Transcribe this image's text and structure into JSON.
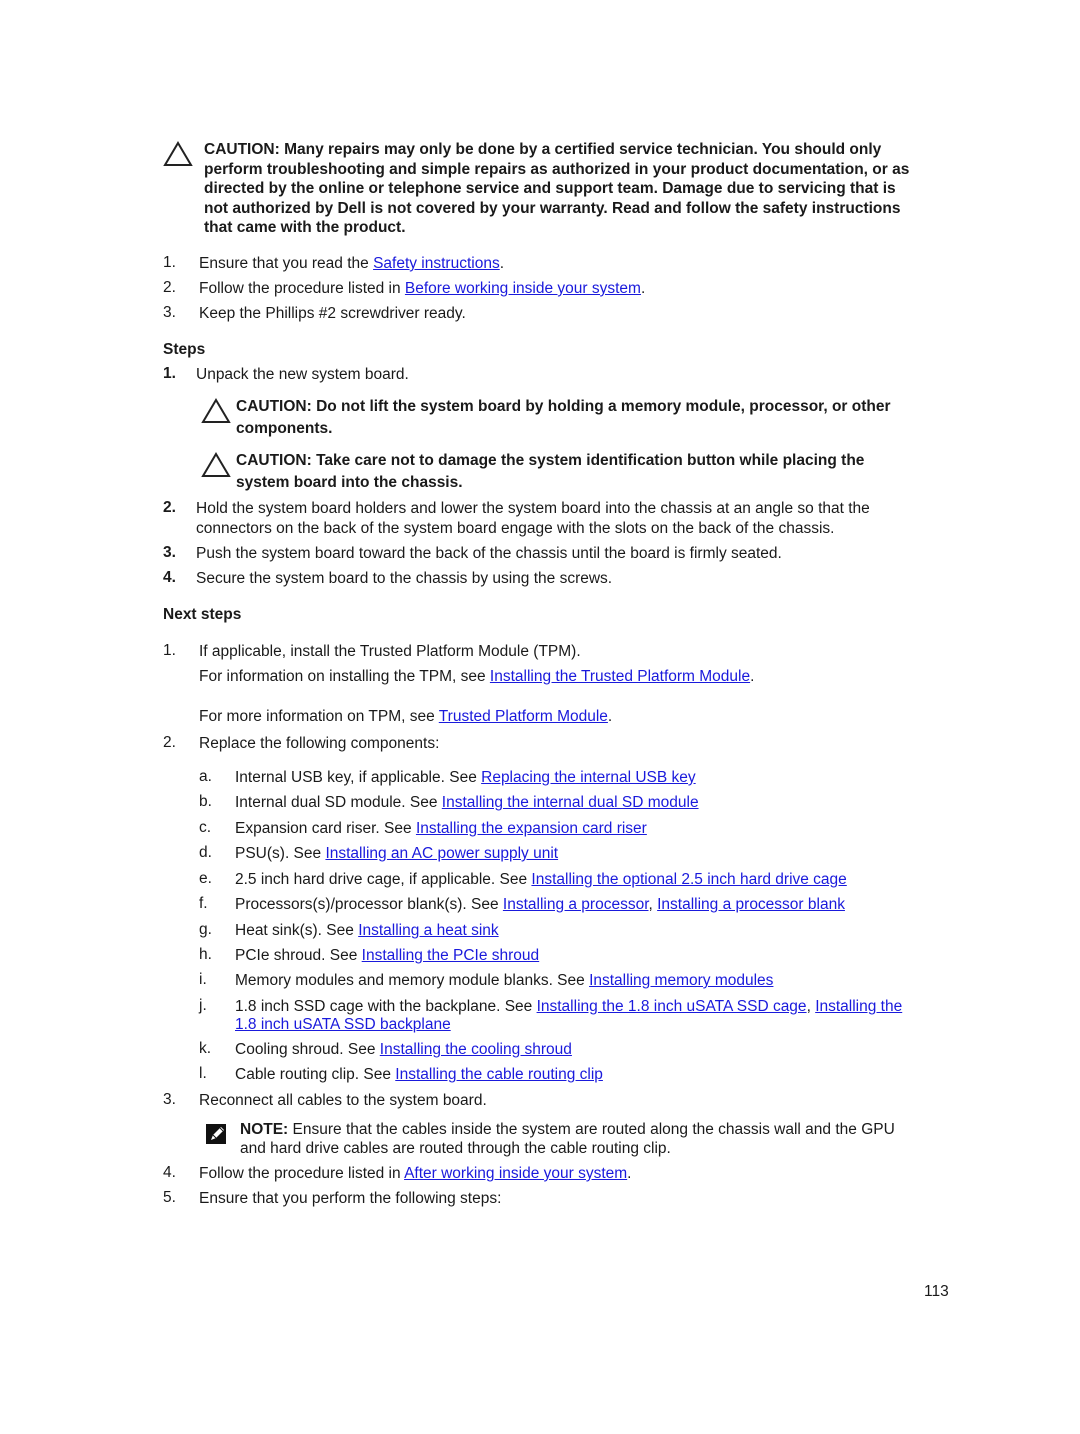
{
  "caution_top": {
    "icon": "caution-triangle-icon",
    "lines": [
      "CAUTION: Many repairs may only be done by a certified service technician. You should only",
      "perform troubleshooting and simple repairs as authorized in your product documentation, or as",
      "directed by the online or telephone service and support team. Damage due to servicing that is",
      "not authorized by Dell is not covered by your warranty. Read and follow the safety instructions",
      "that came with the product."
    ]
  },
  "prereq": [
    {
      "num": "1.",
      "pre": "Ensure that you read the ",
      "link": "Safety instructions",
      "post": "."
    },
    {
      "num": "2.",
      "pre": "Follow the procedure listed in ",
      "link": "Before working inside your system",
      "post": "."
    },
    {
      "num": "3.",
      "text": "Keep the Phillips #2 screwdriver ready."
    }
  ],
  "steps": {
    "heading": "Steps",
    "items": [
      {
        "num": "1.",
        "text": "Unpack the new system board."
      },
      {
        "num": "2.",
        "lines": [
          "Hold the system board holders and lower the system board into the chassis at an angle so that the",
          "connectors on the back of the system board engage with the slots on the back of the chassis."
        ]
      },
      {
        "num": "3.",
        "text": "Push the system board toward the back of the chassis until the board is firmly seated."
      },
      {
        "num": "4.",
        "text": "Secure the system board to the chassis by using the screws."
      }
    ],
    "cautions": [
      {
        "icon": "caution-triangle-icon",
        "lines": [
          "CAUTION: Do not lift the system board by holding a memory module, processor, or other",
          "components."
        ]
      },
      {
        "icon": "caution-triangle-icon",
        "lines": [
          "CAUTION: Take care not to damage the system identification button while placing the",
          "system board into the chassis."
        ]
      }
    ]
  },
  "next_steps": {
    "heading": "Next steps",
    "item1": {
      "num": "1.",
      "text": "If applicable, install the Trusted Platform Module (TPM).",
      "info1_pre": "For information on installing the TPM, see ",
      "info1_link": "Installing the Trusted Platform Module",
      "info1_post": ".",
      "info2_pre": "For more information on TPM, see ",
      "info2_link": "Trusted Platform Module",
      "info2_post": "."
    },
    "item2": {
      "num": "2.",
      "text": "Replace the following components:",
      "subitems": [
        {
          "letter": "a.",
          "pre": "Internal USB key, if applicable. See ",
          "links": [
            "Replacing the internal USB key"
          ]
        },
        {
          "letter": "b.",
          "pre": "Internal dual SD module. See ",
          "links": [
            "Installing the internal dual SD module"
          ]
        },
        {
          "letter": "c.",
          "pre": "Expansion card riser. See ",
          "links": [
            "Installing the expansion card riser"
          ]
        },
        {
          "letter": "d.",
          "pre": "PSU(s). See ",
          "links": [
            "Installing an AC power supply unit"
          ]
        },
        {
          "letter": "e.",
          "pre": "2.5 inch hard drive cage, if applicable. See ",
          "links": [
            "Installing the optional 2.5 inch hard drive cage"
          ]
        },
        {
          "letter": "f.",
          "pre": "Processors(s)/processor blank(s). See ",
          "links": [
            "Installing a processor",
            "Installing a processor blank"
          ],
          "sep": ", "
        },
        {
          "letter": "g.",
          "pre": "Heat sink(s). See ",
          "links": [
            "Installing a heat sink"
          ]
        },
        {
          "letter": "h.",
          "pre": "PCIe shroud. See ",
          "links": [
            "Installing the PCIe shroud"
          ]
        },
        {
          "letter": "i.",
          "pre": "Memory modules and memory module blanks. See ",
          "links": [
            "Installing memory modules"
          ]
        },
        {
          "letter": "j.",
          "pre": "1.8 inch SSD cage with the backplane. See ",
          "links": [
            "Installing the 1.8 inch uSATA SSD cage",
            "Installing the"
          ],
          "sep": ", ",
          "cont_link": "1.8 inch uSATA SSD backplane"
        },
        {
          "letter": "k.",
          "pre": "Cooling shroud. See ",
          "links": [
            "Installing the cooling shroud"
          ]
        },
        {
          "letter": "l.",
          "pre": "Cable routing clip. See ",
          "links": [
            "Installing the cable routing clip"
          ]
        }
      ]
    },
    "item3": {
      "num": "3.",
      "text": "Reconnect all cables to the system board."
    },
    "note": {
      "icon": "note-pencil-icon",
      "label": "NOTE:",
      "line1": " Ensure that the cables inside the system are routed along the chassis wall and the GPU",
      "line2": "and hard drive cables are routed through the cable routing clip."
    },
    "item4": {
      "num": "4.",
      "pre": "Follow the procedure listed in ",
      "link": "After working inside your system",
      "post": "."
    },
    "item5": {
      "num": "5.",
      "text": "Ensure that you perform the following steps:"
    }
  },
  "page_number": "113",
  "colors": {
    "link": "#1a1adc",
    "text": "#1a1a1a"
  }
}
